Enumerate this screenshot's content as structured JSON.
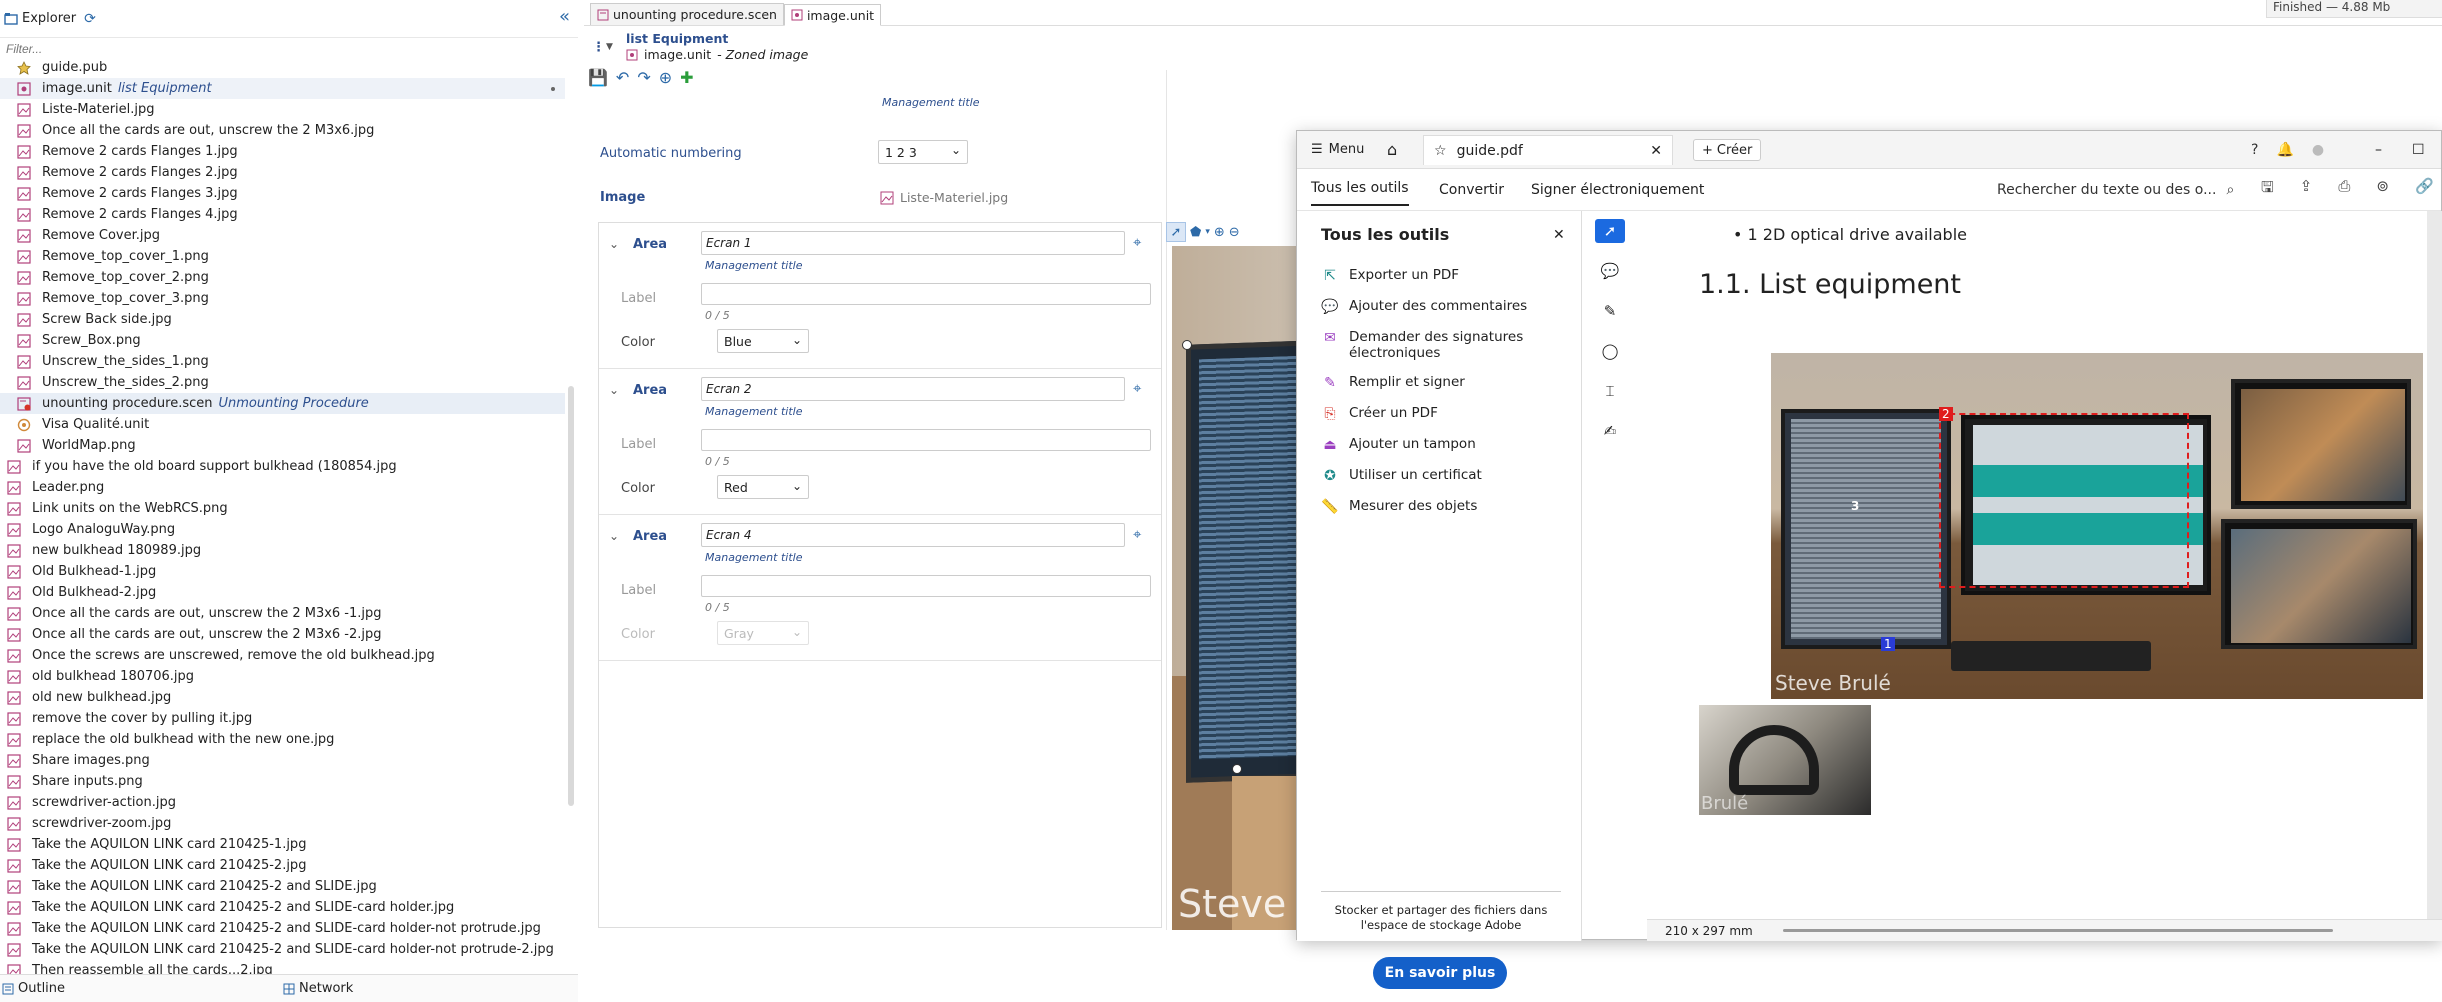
{
  "explorer": {
    "title": "Explorer",
    "filter_placeholder": "Filter...",
    "files": [
      {
        "name": "guide.pub",
        "annot": "",
        "depth": 1,
        "icon": "star"
      },
      {
        "name": "image.unit",
        "annot": "list Equipment",
        "depth": 1,
        "icon": "unit",
        "state": "selected"
      },
      {
        "name": "Liste-Materiel.jpg",
        "annot": "",
        "depth": 1,
        "icon": "img"
      },
      {
        "name": "Once all the cards are out, unscrew the 2 M3x6.jpg",
        "annot": "",
        "depth": 1,
        "icon": "img"
      },
      {
        "name": "Remove 2 cards Flanges 1.jpg",
        "annot": "",
        "depth": 1,
        "icon": "img"
      },
      {
        "name": "Remove 2 cards Flanges 2.jpg",
        "annot": "",
        "depth": 1,
        "icon": "img"
      },
      {
        "name": "Remove 2 cards Flanges 3.jpg",
        "annot": "",
        "depth": 1,
        "icon": "img"
      },
      {
        "name": "Remove 2 cards Flanges 4.jpg",
        "annot": "",
        "depth": 1,
        "icon": "img"
      },
      {
        "name": "Remove Cover.jpg",
        "annot": "",
        "depth": 1,
        "icon": "img"
      },
      {
        "name": "Remove_top_cover_1.png",
        "annot": "",
        "depth": 1,
        "icon": "img"
      },
      {
        "name": "Remove_top_cover_2.png",
        "annot": "",
        "depth": 1,
        "icon": "img"
      },
      {
        "name": "Remove_top_cover_3.png",
        "annot": "",
        "depth": 1,
        "icon": "img"
      },
      {
        "name": "Screw Back side.jpg",
        "annot": "",
        "depth": 1,
        "icon": "img"
      },
      {
        "name": "Screw_Box.png",
        "annot": "",
        "depth": 1,
        "icon": "img"
      },
      {
        "name": "Unscrew_the_sides_1.png",
        "annot": "",
        "depth": 1,
        "icon": "img"
      },
      {
        "name": "Unscrew_the_sides_2.png",
        "annot": "",
        "depth": 1,
        "icon": "img"
      },
      {
        "name": "unounting procedure.scen",
        "annot": "Unmounting Procedure",
        "depth": 1,
        "icon": "scen",
        "state": "highlight"
      },
      {
        "name": "Visa Qualité.unit",
        "annot": "",
        "depth": 1,
        "icon": "unit2"
      },
      {
        "name": "WorldMap.png",
        "annot": "",
        "depth": 1,
        "icon": "img"
      },
      {
        "name": "if you have the old board support bulkhead (180854.jpg",
        "annot": "",
        "depth": 0,
        "icon": "img"
      },
      {
        "name": "Leader.png",
        "annot": "",
        "depth": 0,
        "icon": "img"
      },
      {
        "name": "Link units on the WebRCS.png",
        "annot": "",
        "depth": 0,
        "icon": "img"
      },
      {
        "name": "Logo AnaloguWay.png",
        "annot": "",
        "depth": 0,
        "icon": "img"
      },
      {
        "name": "new bulkhead 180989.jpg",
        "annot": "",
        "depth": 0,
        "icon": "img"
      },
      {
        "name": "Old Bulkhead-1.jpg",
        "annot": "",
        "depth": 0,
        "icon": "img"
      },
      {
        "name": "Old Bulkhead-2.jpg",
        "annot": "",
        "depth": 0,
        "icon": "img"
      },
      {
        "name": "Once all the cards are out, unscrew the 2 M3x6 -1.jpg",
        "annot": "",
        "depth": 0,
        "icon": "img"
      },
      {
        "name": "Once all the cards are out, unscrew the 2 M3x6 -2.jpg",
        "annot": "",
        "depth": 0,
        "icon": "img"
      },
      {
        "name": "Once the screws are unscrewed, remove the old bulkhead.jpg",
        "annot": "",
        "depth": 0,
        "icon": "img"
      },
      {
        "name": "old bulkhead 180706.jpg",
        "annot": "",
        "depth": 0,
        "icon": "img"
      },
      {
        "name": "old new bulkhead.jpg",
        "annot": "",
        "depth": 0,
        "icon": "img"
      },
      {
        "name": "remove the cover by pulling it.jpg",
        "annot": "",
        "depth": 0,
        "icon": "img"
      },
      {
        "name": "replace the old bulkhead with the new one.jpg",
        "annot": "",
        "depth": 0,
        "icon": "img"
      },
      {
        "name": "Share images.png",
        "annot": "",
        "depth": 0,
        "icon": "img"
      },
      {
        "name": "Share inputs.png",
        "annot": "",
        "depth": 0,
        "icon": "img"
      },
      {
        "name": "screwdriver-action.jpg",
        "annot": "",
        "depth": 0,
        "icon": "img"
      },
      {
        "name": "screwdriver-zoom.jpg",
        "annot": "",
        "depth": 0,
        "icon": "img"
      },
      {
        "name": "Take the AQUILON LINK card 210425-1.jpg",
        "annot": "",
        "depth": 0,
        "icon": "img"
      },
      {
        "name": "Take the AQUILON LINK card 210425-2.jpg",
        "annot": "",
        "depth": 0,
        "icon": "img"
      },
      {
        "name": "Take the AQUILON LINK card 210425-2 and SLIDE.jpg",
        "annot": "",
        "depth": 0,
        "icon": "img"
      },
      {
        "name": "Take the AQUILON LINK card 210425-2 and SLIDE-card holder.jpg",
        "annot": "",
        "depth": 0,
        "icon": "img"
      },
      {
        "name": "Take the AQUILON LINK card 210425-2 and SLIDE-card holder-not protrude.jpg",
        "annot": "",
        "depth": 0,
        "icon": "img"
      },
      {
        "name": "Take the AQUILON LINK card 210425-2 and SLIDE-card holder-not protrude-2.jpg",
        "annot": "",
        "depth": 0,
        "icon": "img"
      },
      {
        "name": "Then reassemble all the cards...2.jpg",
        "annot": "",
        "depth": 0,
        "icon": "img"
      }
    ]
  },
  "bottom_tabs": {
    "outline": "Outline",
    "network": "Network"
  },
  "editor": {
    "tabs": [
      {
        "label": "unounting procedure.scen",
        "active": false
      },
      {
        "label": "image.unit",
        "active": true
      }
    ],
    "crumb_title": "list Equipment",
    "crumb_file": "image.unit",
    "crumb_suffix": "- Zoned image",
    "management_title": "Management title",
    "autonum_label": "Automatic numbering",
    "autonum_value": "1 2 3",
    "image_label": "Image",
    "image_file": "Liste-Materiel.jpg",
    "area_title": "Area",
    "label_text": "Label",
    "color_text": "Color",
    "areas": [
      {
        "name": "Ecran 1",
        "count": "0 / 5",
        "color": "Blue"
      },
      {
        "name": "Ecran 2",
        "count": "0 / 5",
        "color": "Red"
      },
      {
        "name": "Ecran 4",
        "count": "0 / 5",
        "color": "Gray"
      }
    ],
    "image_watermark": "Steve B"
  },
  "status": "Finished — 4.88 Mb",
  "pdf": {
    "menu": "Menu",
    "doc_tab": "guide.pdf",
    "create": "Créer",
    "subtabs": [
      "Tous les outils",
      "Convertir",
      "Signer électroniquement"
    ],
    "search": "Rechercher du texte ou des o...",
    "panel_title": "Tous les outils",
    "tools": [
      {
        "label": "Exporter un PDF",
        "icon": "export-icon",
        "color": "#1f8a8a"
      },
      {
        "label": "Ajouter des commentaires",
        "icon": "comment-icon",
        "color": "#d9a400"
      },
      {
        "label": "Demander des signatures électroniques",
        "icon": "request-signature-icon",
        "color": "#9b3fc0"
      },
      {
        "label": "Remplir et signer",
        "icon": "fill-sign-icon",
        "color": "#9b3fc0"
      },
      {
        "label": "Créer un PDF",
        "icon": "create-pdf-icon",
        "color": "#d6332a"
      },
      {
        "label": "Ajouter un tampon",
        "icon": "stamp-icon",
        "color": "#9b3fc0"
      },
      {
        "label": "Utiliser un certificat",
        "icon": "certificate-icon",
        "color": "#1f8a8a"
      },
      {
        "label": "Mesurer des objets",
        "icon": "measure-icon",
        "color": "#9b3fc0"
      }
    ],
    "promo": "Stocker et partager des fichiers dans l'espace de stockage Adobe",
    "cta": "En savoir plus",
    "bullet": "1 2D optical drive available",
    "heading": "1.1. List equipment",
    "zone_labels": [
      "2",
      "3",
      "1"
    ],
    "photo_watermark": "Steve Brulé",
    "photo2_watermark": "Brulé",
    "page_size": "210 x 297 mm"
  }
}
